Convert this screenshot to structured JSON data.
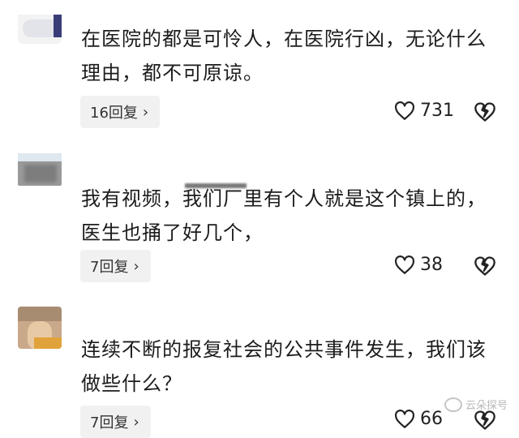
{
  "comments": [
    {
      "text": "在医院的都是可怜人，在医院行凶，无论什么理由，都不可原谅。",
      "reply_label": "16回复",
      "likes": "731"
    },
    {
      "text": "我有视频，我们厂里有个人就是这个镇上的，医生也捅了好几个，",
      "reply_label": "7回复",
      "likes": "38"
    },
    {
      "text": "连续不断的报复社会的公共事件发生，我们该做些什么？",
      "reply_label": "7回复",
      "likes": "66"
    }
  ],
  "icons": {
    "reply_chevron": "chevron-right-icon",
    "like": "heart-icon",
    "dislike": "broken-heart-icon"
  },
  "watermark": "云朵探号"
}
